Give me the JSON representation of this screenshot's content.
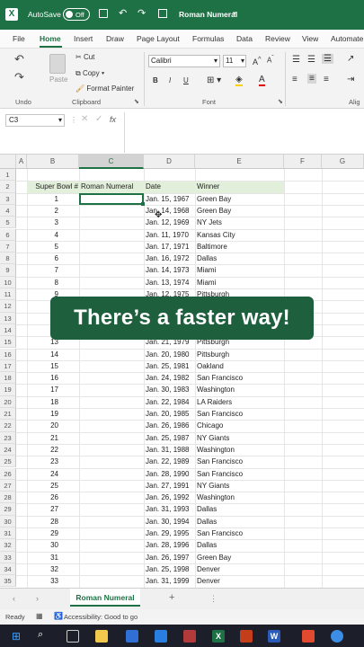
{
  "titlebar": {
    "autosave_label": "AutoSave",
    "autosave_state": "Off",
    "doc_title": "Roman Numeral"
  },
  "tabs": [
    "File",
    "Home",
    "Insert",
    "Draw",
    "Page Layout",
    "Formulas",
    "Data",
    "Review",
    "View",
    "Automate"
  ],
  "active_tab": "Home",
  "ribbon": {
    "undo_group": "Undo",
    "clipboard": {
      "paste": "Paste",
      "cut": "Cut",
      "copy": "Copy",
      "format_painter": "Format Painter",
      "group": "Clipboard"
    },
    "font": {
      "name": "Calibri",
      "size": "11",
      "group": "Font"
    },
    "alignment_group": "Alig"
  },
  "formula": {
    "name_box": "C3",
    "fx": "fx",
    "value": ""
  },
  "columns": [
    "A",
    "B",
    "C",
    "D",
    "E",
    "F",
    "G"
  ],
  "header_row": {
    "row": "2",
    "b": "Super Bowl #",
    "c": "Roman Numeral",
    "d": "Date",
    "e": "Winner"
  },
  "rows": [
    {
      "r": "1",
      "b": "",
      "d": "",
      "e": ""
    },
    {
      "r": "3",
      "b": "1",
      "d": "Jan. 15, 1967",
      "e": "Green Bay"
    },
    {
      "r": "4",
      "b": "2",
      "d": "Jan. 14, 1968",
      "e": "Green Bay"
    },
    {
      "r": "5",
      "b": "3",
      "d": "Jan. 12, 1969",
      "e": "NY Jets"
    },
    {
      "r": "6",
      "b": "4",
      "d": "Jan. 11, 1970",
      "e": "Kansas City"
    },
    {
      "r": "7",
      "b": "5",
      "d": "Jan. 17, 1971",
      "e": "Baltimore"
    },
    {
      "r": "8",
      "b": "6",
      "d": "Jan. 16, 1972",
      "e": "Dallas"
    },
    {
      "r": "9",
      "b": "7",
      "d": "Jan. 14, 1973",
      "e": "Miami"
    },
    {
      "r": "10",
      "b": "8",
      "d": "Jan. 13, 1974",
      "e": "Miami"
    },
    {
      "r": "11",
      "b": "9",
      "d": "Jan. 12, 1975",
      "e": "Pittsburgh"
    },
    {
      "r": "12",
      "b": "",
      "d": "",
      "e": ""
    },
    {
      "r": "13",
      "b": "",
      "d": "",
      "e": ""
    },
    {
      "r": "14",
      "b": "",
      "d": "",
      "e": ""
    },
    {
      "r": "15",
      "b": "13",
      "d": "Jan. 21, 1979",
      "e": "Pittsburgh"
    },
    {
      "r": "16",
      "b": "14",
      "d": "Jan. 20, 1980",
      "e": "Pittsburgh"
    },
    {
      "r": "17",
      "b": "15",
      "d": "Jan. 25, 1981",
      "e": "Oakland"
    },
    {
      "r": "18",
      "b": "16",
      "d": "Jan. 24, 1982",
      "e": "San Francisco"
    },
    {
      "r": "19",
      "b": "17",
      "d": "Jan. 30, 1983",
      "e": "Washington"
    },
    {
      "r": "20",
      "b": "18",
      "d": "Jan. 22, 1984",
      "e": "LA Raiders"
    },
    {
      "r": "21",
      "b": "19",
      "d": "Jan. 20, 1985",
      "e": "San Francisco"
    },
    {
      "r": "22",
      "b": "20",
      "d": "Jan. 26, 1986",
      "e": "Chicago"
    },
    {
      "r": "23",
      "b": "21",
      "d": "Jan. 25, 1987",
      "e": "NY Giants"
    },
    {
      "r": "24",
      "b": "22",
      "d": "Jan. 31, 1988",
      "e": "Washington"
    },
    {
      "r": "25",
      "b": "23",
      "d": "Jan. 22, 1989",
      "e": "San Francisco"
    },
    {
      "r": "26",
      "b": "24",
      "d": "Jan. 28, 1990",
      "e": "San Francisco"
    },
    {
      "r": "27",
      "b": "25",
      "d": "Jan. 27, 1991",
      "e": "NY Giants"
    },
    {
      "r": "28",
      "b": "26",
      "d": "Jan. 26, 1992",
      "e": "Washington"
    },
    {
      "r": "29",
      "b": "27",
      "d": "Jan. 31, 1993",
      "e": "Dallas"
    },
    {
      "r": "30",
      "b": "28",
      "d": "Jan. 30, 1994",
      "e": "Dallas"
    },
    {
      "r": "31",
      "b": "29",
      "d": "Jan. 29, 1995",
      "e": "San Francisco"
    },
    {
      "r": "32",
      "b": "30",
      "d": "Jan. 28, 1996",
      "e": "Dallas"
    },
    {
      "r": "33",
      "b": "31",
      "d": "Jan. 26, 1997",
      "e": "Green Bay"
    },
    {
      "r": "34",
      "b": "32",
      "d": "Jan. 25, 1998",
      "e": "Denver"
    },
    {
      "r": "35",
      "b": "33",
      "d": "Jan. 31, 1999",
      "e": "Denver"
    }
  ],
  "banner": "There’s a faster way!",
  "sheet_tab": "Roman Numeral",
  "status": {
    "ready": "Ready",
    "accessibility": "Accessibility: Good to go"
  },
  "colors": {
    "excel_green": "#1e7145",
    "banner_green": "#1e5f3d",
    "header_fill": "#e2efda"
  }
}
